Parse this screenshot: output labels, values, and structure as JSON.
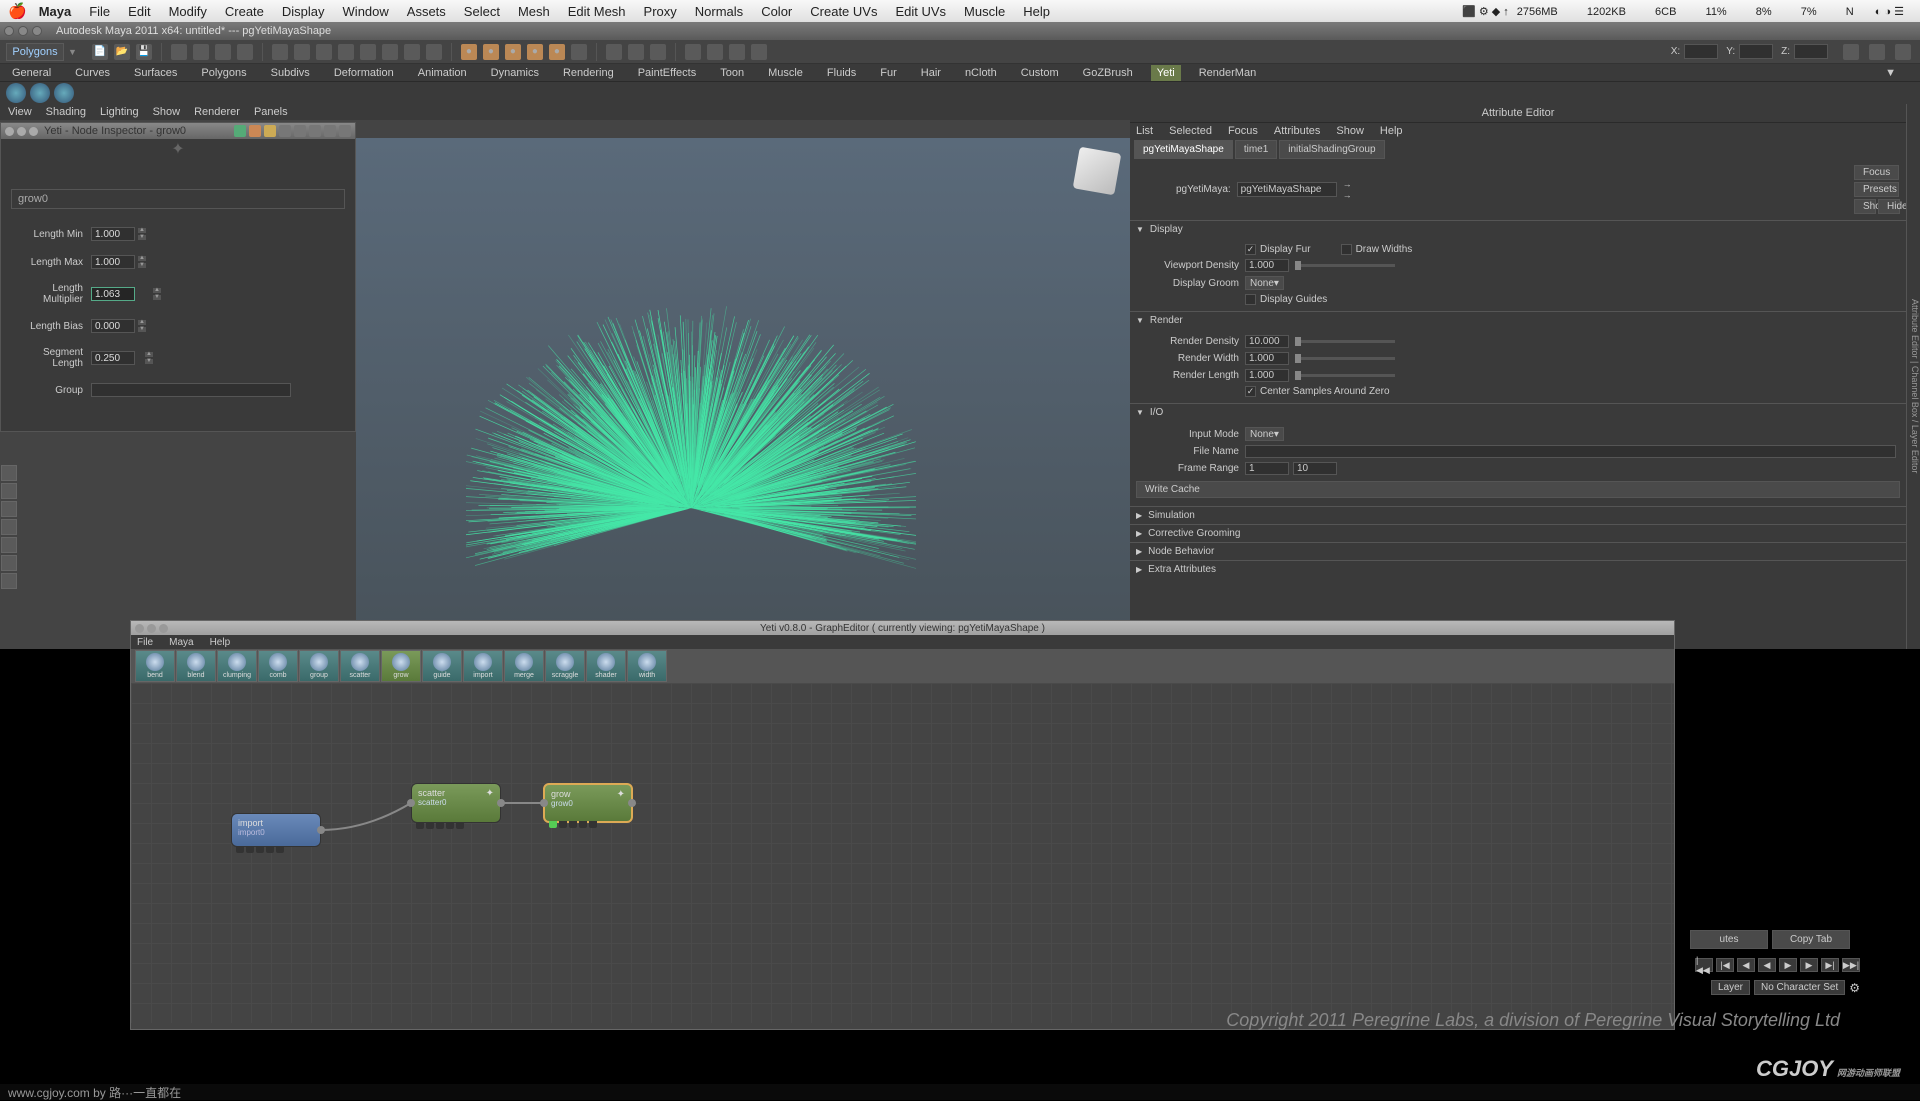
{
  "menubar": {
    "app": "Maya",
    "items": [
      "File",
      "Edit",
      "Modify",
      "Create",
      "Display",
      "Window",
      "Assets",
      "Select",
      "Mesh",
      "Edit Mesh",
      "Proxy",
      "Normals",
      "Color",
      "Create UVs",
      "Edit UVs",
      "Muscle",
      "Help"
    ],
    "status": [
      "2756MB",
      "1202KB",
      "6CB",
      "11%",
      "8%",
      "7%",
      "N"
    ]
  },
  "titlebar": "Autodesk Maya 2011 x64: untitled*   ---   pgYetiMayaShape",
  "toolbar": {
    "mode": "Polygons",
    "xyz": {
      "x": "X:",
      "y": "Y:",
      "z": "Z:"
    }
  },
  "shelf": [
    "General",
    "Curves",
    "Surfaces",
    "Polygons",
    "Subdivs",
    "Deformation",
    "Animation",
    "Dynamics",
    "Rendering",
    "PaintEffects",
    "Toon",
    "Muscle",
    "Fluids",
    "Fur",
    "Hair",
    "nCloth",
    "Custom",
    "GoZBrush",
    "Yeti",
    "RenderMan"
  ],
  "shelf_active": "Yeti",
  "vp_menu": [
    "View",
    "Shading",
    "Lighting",
    "Show",
    "Renderer",
    "Panels"
  ],
  "node_inspector": {
    "title": "Yeti - Node Inspector - grow0",
    "node_name": "grow0",
    "fields": [
      {
        "label": "Length Min",
        "value": "1.000"
      },
      {
        "label": "Length Max",
        "value": "1.000"
      },
      {
        "label": "Length Multiplier",
        "value": "1.063",
        "active": true
      },
      {
        "label": "Length Bias",
        "value": "0.000"
      },
      {
        "label": "Segment Length",
        "value": "0.250"
      }
    ],
    "group_label": "Group"
  },
  "attr_editor": {
    "title": "Attribute Editor",
    "menu": [
      "List",
      "Selected",
      "Focus",
      "Attributes",
      "Show",
      "Help"
    ],
    "tabs": [
      "pgYetiMayaShape",
      "time1",
      "initialShadingGroup"
    ],
    "active_tab": "pgYetiMayaShape",
    "name_label": "pgYetiMaya:",
    "name_value": "pgYetiMayaShape",
    "buttons": [
      "Focus",
      "Presets"
    ],
    "buttons2": [
      "Show",
      "Hide"
    ],
    "display": {
      "title": "Display",
      "display_fur": "Display Fur",
      "draw_widths": "Draw Widths",
      "viewport_density": "Viewport Density",
      "vd_val": "1.000",
      "display_groom": "Display Groom",
      "groom_val": "None",
      "display_guides": "Display Guides"
    },
    "render": {
      "title": "Render",
      "render_density": "Render Density",
      "rd_val": "10.000",
      "render_width": "Render Width",
      "rw_val": "1.000",
      "render_length": "Render Length",
      "rl_val": "1.000",
      "center": "Center Samples Around Zero"
    },
    "io": {
      "title": "I/O",
      "input_mode": "Input Mode",
      "im_val": "None",
      "file_name": "File Name",
      "frame_range": "Frame Range",
      "fr1": "1",
      "fr2": "10",
      "write_cache": "Write Cache"
    },
    "collapsed": [
      "Simulation",
      "Corrective Grooming",
      "Node Behavior",
      "Extra Attributes"
    ]
  },
  "graph_editor": {
    "title": "Yeti v0.8.0 - GraphEditor ( currently viewing: pgYetiMayaShape )",
    "menu": [
      "File",
      "Maya",
      "Help"
    ],
    "tools": [
      "bend",
      "blend",
      "clumping",
      "comb",
      "group",
      "scatter",
      "grow",
      "guide",
      "import",
      "merge",
      "scraggle",
      "shader",
      "width"
    ],
    "nodes": {
      "import": {
        "label": "import",
        "sub": "import0"
      },
      "scatter": {
        "label": "scatter",
        "sub": "scatter0"
      },
      "grow": {
        "label": "grow",
        "sub": "grow0"
      }
    }
  },
  "bottom_btns": [
    "utes",
    "Copy Tab"
  ],
  "layer": {
    "layer": "Layer",
    "charset": "No Character Set"
  },
  "copyright": "Copyright 2011 Peregrine Labs, a division of Peregrine Visual Storytelling Ltd",
  "logo": "CGJOY",
  "logo_sub": "网游动画师联盟",
  "footer": "www.cgjoy.com by 路···一直都在"
}
